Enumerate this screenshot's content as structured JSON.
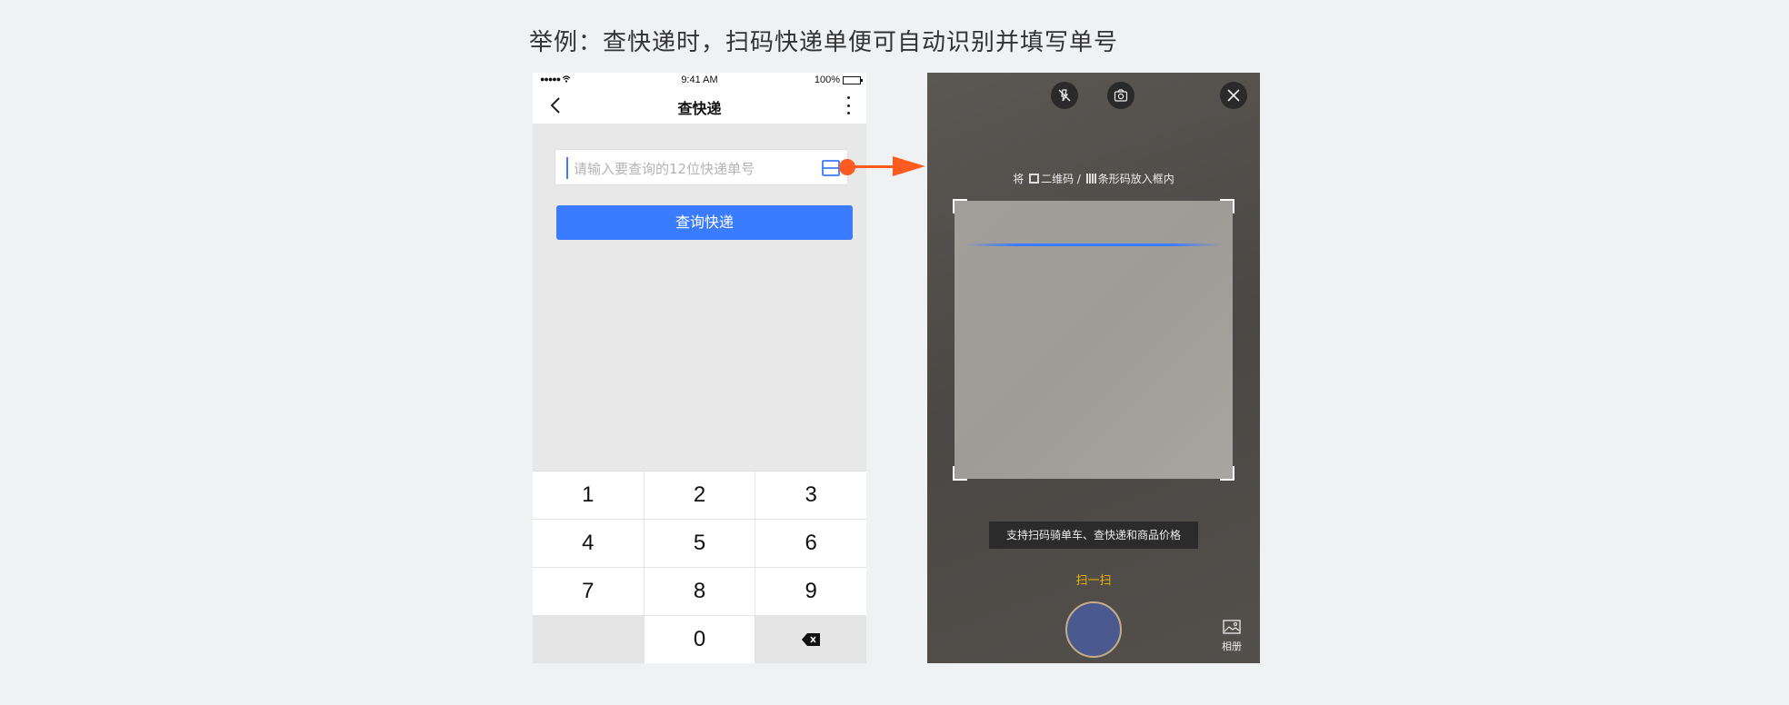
{
  "caption": "举例：查快递时，扫码快递单便可自动识别并填写单号",
  "left_phone": {
    "status": {
      "signal": "●●●●● ",
      "time": "9:41 AM",
      "battery": "100%"
    },
    "nav": {
      "title": "查快递"
    },
    "search": {
      "placeholder": "请输入要查询的12位快递单号"
    },
    "query_button": "查询快递",
    "keypad": [
      "1",
      "2",
      "3",
      "4",
      "5",
      "6",
      "7",
      "8",
      "9",
      "",
      "0",
      ""
    ]
  },
  "right_phone": {
    "hint_before": "将",
    "hint_qr": "二维码 /",
    "hint_bc": "条形码放入框内",
    "support_tip": "支持扫码骑单车、查快递和商品价格",
    "scan_label": "扫一扫",
    "album_label": "相册"
  },
  "colors": {
    "accent": "#3b7bff",
    "connector": "#ff5a1f",
    "scan_label": "#f0b300"
  }
}
